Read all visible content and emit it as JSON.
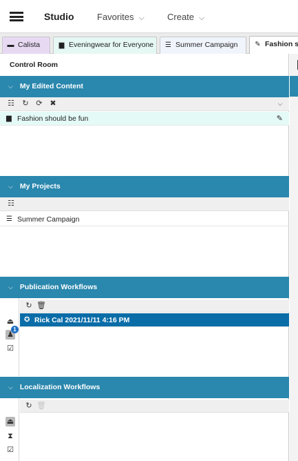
{
  "header": {
    "menu_icon": "hamburger-icon",
    "brand": "Studio",
    "favorites_label": "Favorites",
    "create_label": "Create",
    "chevron": "⌵"
  },
  "tabs": [
    {
      "label": "Calista",
      "icon": "user-card-icon",
      "color": "#e8d9f3"
    },
    {
      "label": "Eveningwear for Everyone",
      "icon": "document-icon",
      "color": "#e6f8f4"
    },
    {
      "label": "Summer Campaign",
      "icon": "list-icon",
      "color": "#f0f4fb"
    },
    {
      "label": "Fashion sh",
      "icon": "pencil-icon",
      "color": "#ffffff",
      "active": true
    }
  ],
  "control_room": {
    "title": "Control Room",
    "sections": {
      "edited": {
        "title": "My Edited Content",
        "items": [
          {
            "label": "Fashion should be fun",
            "icon": "document-icon",
            "action_icon": "pencil-icon"
          }
        ]
      },
      "projects": {
        "title": "My Projects",
        "items": [
          {
            "label": "Summer Campaign",
            "icon": "list-icon"
          }
        ]
      },
      "publication": {
        "title": "Publication Workflows",
        "badge": "1",
        "items": [
          {
            "label": "Rick Cal 2021/11/11 4:16 PM",
            "icon": "workflow-icon",
            "selected": true
          }
        ]
      },
      "localization": {
        "title": "Localization Workflows",
        "items": []
      }
    }
  },
  "colors": {
    "accent": "#2a87ad",
    "selected_row": "#0b6da8",
    "badge": "#1d6fc4"
  }
}
